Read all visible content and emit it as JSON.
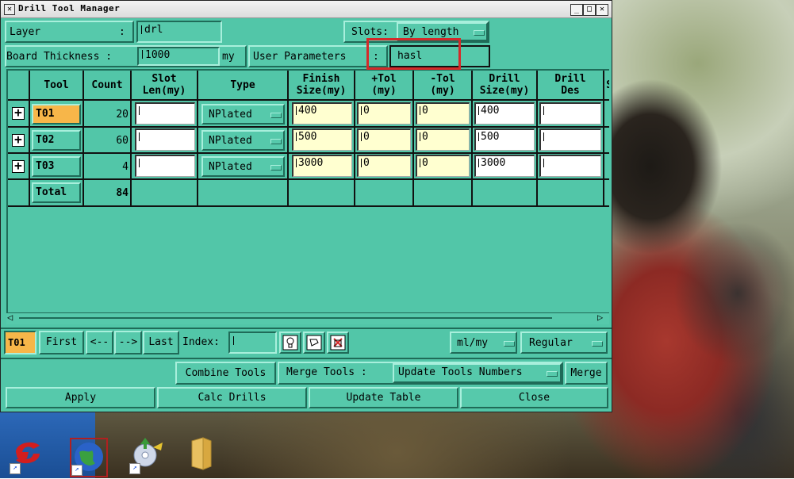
{
  "window": {
    "title": "Drill Tool Manager"
  },
  "header": {
    "layer_label": "Layer",
    "layer_colon": ":",
    "layer_value": "drl",
    "slots_label": "Slots:",
    "slots_value": "By length",
    "board_thickness_label": "Board Thickness :",
    "board_thickness_value": "1000",
    "board_thickness_unit": "my",
    "user_params_label": "User Parameters",
    "user_params_colon": ":",
    "user_params_value": "hasl"
  },
  "table": {
    "columns": [
      "Tool",
      "Count",
      "Slot\nLen(my)",
      "Type",
      "Finish\nSize(my)",
      "+Tol\n(my)",
      "-Tol\n(my)",
      "Drill\nSize(my)",
      "Drill\nDes",
      "S"
    ],
    "rows": [
      {
        "tool": "T01",
        "count": "20",
        "slot_len": "",
        "type": "NPlated",
        "finish": "400",
        "ptol": "0",
        "mtol": "0",
        "drill": "400",
        "des": "",
        "selected": true
      },
      {
        "tool": "T02",
        "count": "60",
        "slot_len": "",
        "type": "NPlated",
        "finish": "500",
        "ptol": "0",
        "mtol": "0",
        "drill": "500",
        "des": "",
        "selected": false
      },
      {
        "tool": "T03",
        "count": "4",
        "slot_len": "",
        "type": "NPlated",
        "finish": "3000",
        "ptol": "0",
        "mtol": "0",
        "drill": "3000",
        "des": "",
        "selected": false
      }
    ],
    "total_label": "Total",
    "total_count": "84"
  },
  "nav": {
    "current_tool": "T01",
    "first": "First",
    "prev": "<--",
    "next": "-->",
    "last": "Last",
    "index_label": "Index:",
    "index_value": "",
    "units": "ml/my",
    "mode": "Regular"
  },
  "actions": {
    "combine": "Combine Tools",
    "merge_tools": "Merge Tools :",
    "merge_option": "Update Tools Numbers",
    "merge": "Merge",
    "apply": "Apply",
    "calc": "Calc Drills",
    "update": "Update Table",
    "close": "Close"
  },
  "colors": {
    "panel": "#52c6a8",
    "selected": "#f7b649",
    "highlight": "#d42a2a"
  }
}
